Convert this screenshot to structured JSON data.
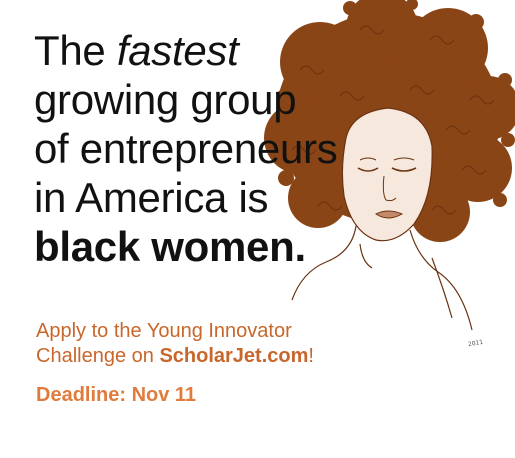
{
  "headline": {
    "line1_prefix": "The ",
    "line1_emphasis": "fastest",
    "line2": "growing group",
    "line3": "of entrepreneurs",
    "line4": "in America is",
    "line5": "black women."
  },
  "cta": {
    "line1": "Apply to the Young Innovator",
    "line2_prefix": "Challenge on ",
    "line2_site": "ScholarJet.com",
    "line2_suffix": "!"
  },
  "deadline": "Deadline: Nov 11",
  "artist_signature": "2011",
  "colors": {
    "hair": "#8a4516",
    "hair_shadow": "#6e3510",
    "skin": "#f6e8dc",
    "line_art": "#6b3311",
    "text": "#111111",
    "accent": "#c8672b",
    "accent_light": "#e07b3c"
  }
}
